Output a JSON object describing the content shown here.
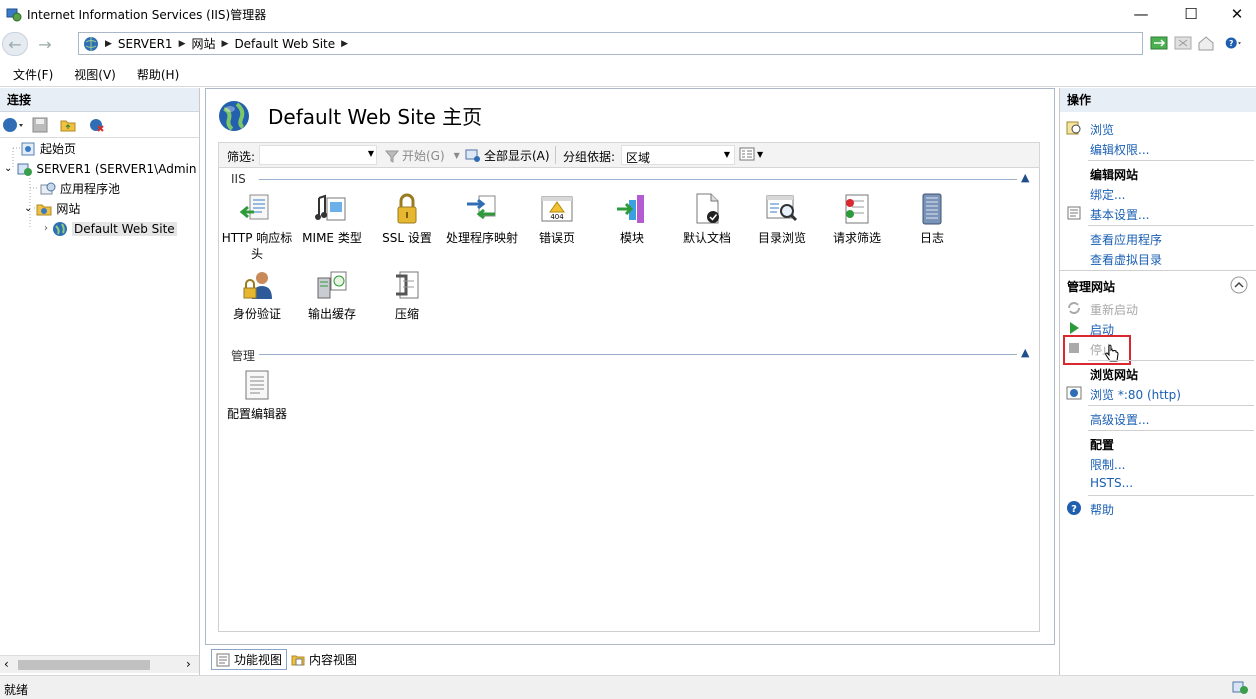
{
  "window": {
    "title": "Internet Information Services (IIS)管理器",
    "minimize": "—",
    "maximize": "☐",
    "close": "✕"
  },
  "address": {
    "crumbs": [
      "SERVER1",
      "网站",
      "Default Web Site"
    ]
  },
  "menu": [
    "文件(F)",
    "视图(V)",
    "帮助(H)"
  ],
  "connections": {
    "header": "连接",
    "tree": [
      {
        "label": "起始页"
      },
      {
        "label": "SERVER1 (SERVER1\\Admin"
      },
      {
        "label": "应用程序池"
      },
      {
        "label": "网站"
      },
      {
        "label": "Default Web Site"
      }
    ]
  },
  "center": {
    "title": "Default Web Site 主页",
    "filter_label": "筛选:",
    "start_label": "开始(G)",
    "show_all_label": "全部显示(A)",
    "group_by_label": "分组依据:",
    "group_by_value": "区域",
    "sections": [
      {
        "name": "IIS",
        "features": [
          {
            "label": "HTTP 响应标头",
            "icon": "http-response-headers-icon"
          },
          {
            "label": "MIME 类型",
            "icon": "mime-types-icon"
          },
          {
            "label": "SSL 设置",
            "icon": "ssl-settings-icon"
          },
          {
            "label": "处理程序映射",
            "icon": "handler-mappings-icon"
          },
          {
            "label": "错误页",
            "icon": "error-pages-icon"
          },
          {
            "label": "模块",
            "icon": "modules-icon"
          },
          {
            "label": "默认文档",
            "icon": "default-document-icon"
          },
          {
            "label": "目录浏览",
            "icon": "directory-browsing-icon"
          },
          {
            "label": "请求筛选",
            "icon": "request-filtering-icon"
          },
          {
            "label": "日志",
            "icon": "logging-icon"
          },
          {
            "label": "身份验证",
            "icon": "authentication-icon"
          },
          {
            "label": "输出缓存",
            "icon": "output-caching-icon"
          },
          {
            "label": "压缩",
            "icon": "compression-icon"
          }
        ]
      },
      {
        "name": "管理",
        "features": [
          {
            "label": "配置编辑器",
            "icon": "configuration-editor-icon"
          }
        ]
      }
    ],
    "error_page_badge": "404"
  },
  "bottom_tabs": [
    "功能视图",
    "内容视图"
  ],
  "actions": {
    "header": "操作",
    "browse": "浏览",
    "edit_permissions": "编辑权限...",
    "edit_site_header": "编辑网站",
    "bindings": "绑定...",
    "basic_settings": "基本设置...",
    "view_applications": "查看应用程序",
    "view_virtual_dirs": "查看虚拟目录",
    "manage_site_header": "管理网站",
    "restart": "重新启动",
    "start": "启动",
    "stop": "停止",
    "browse_site_header": "浏览网站",
    "browse_http": "浏览 *:80 (http)",
    "advanced_settings": "高级设置...",
    "config_header": "配置",
    "limits": "限制...",
    "hsts": "HSTS...",
    "help": "帮助"
  },
  "status": "就绪",
  "colors": {
    "link": "#1a5fb4",
    "highlight_box": "#d9282f",
    "pane_header": "#e8eef6"
  }
}
